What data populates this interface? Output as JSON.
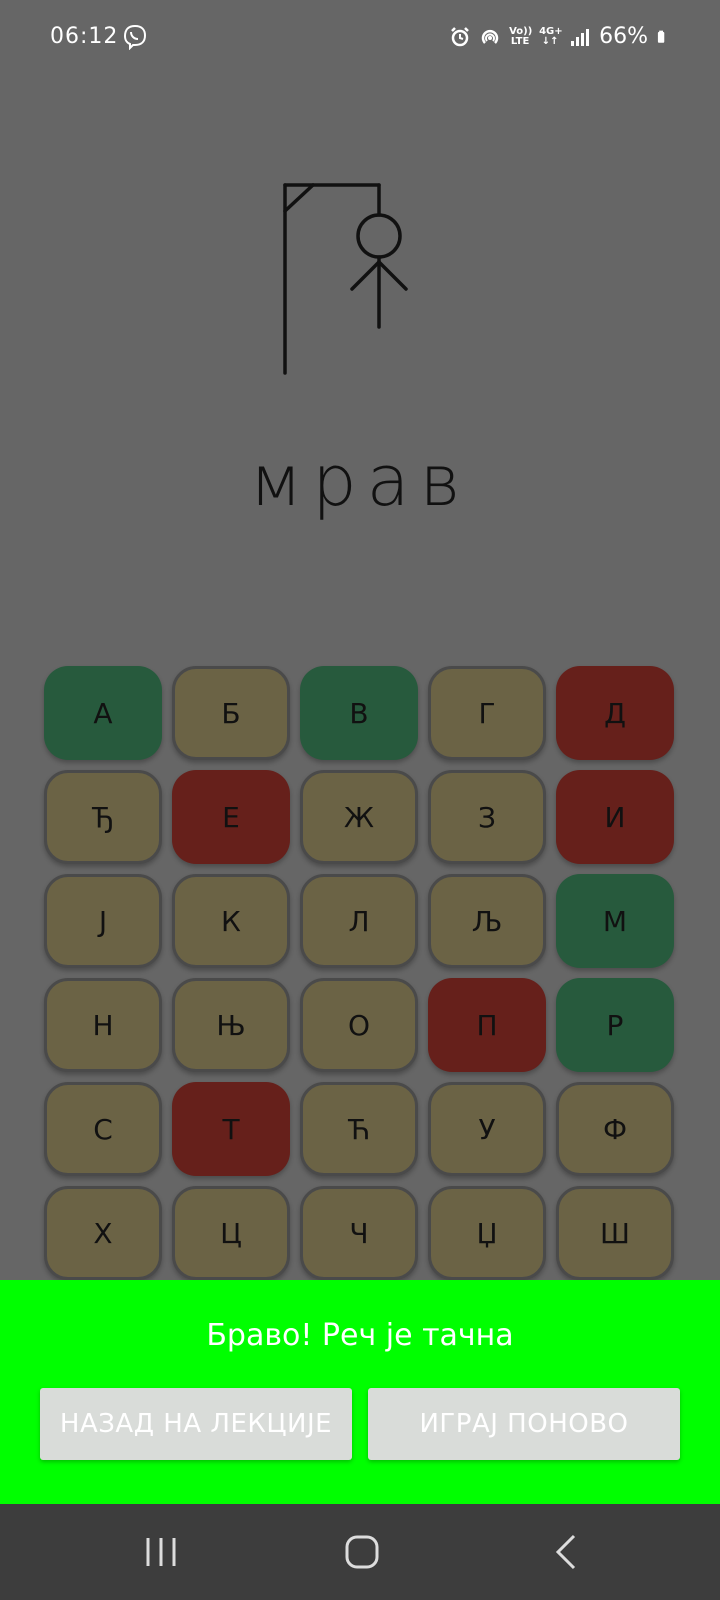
{
  "status_bar": {
    "time": "06:12",
    "battery": "66%",
    "network_top": "4G+",
    "volte_top": "Vo))",
    "volte_bottom": "LTE"
  },
  "game": {
    "word": "мрав"
  },
  "keyboard": {
    "keys": [
      {
        "letter": "А",
        "state": "correct"
      },
      {
        "letter": "Б",
        "state": "neutral"
      },
      {
        "letter": "В",
        "state": "correct"
      },
      {
        "letter": "Г",
        "state": "neutral"
      },
      {
        "letter": "Д",
        "state": "wrong"
      },
      {
        "letter": "Ђ",
        "state": "neutral"
      },
      {
        "letter": "Е",
        "state": "wrong"
      },
      {
        "letter": "Ж",
        "state": "neutral"
      },
      {
        "letter": "З",
        "state": "neutral"
      },
      {
        "letter": "И",
        "state": "wrong"
      },
      {
        "letter": "Ј",
        "state": "neutral"
      },
      {
        "letter": "К",
        "state": "neutral"
      },
      {
        "letter": "Л",
        "state": "neutral"
      },
      {
        "letter": "Љ",
        "state": "neutral"
      },
      {
        "letter": "М",
        "state": "correct"
      },
      {
        "letter": "Н",
        "state": "neutral"
      },
      {
        "letter": "Њ",
        "state": "neutral"
      },
      {
        "letter": "О",
        "state": "neutral"
      },
      {
        "letter": "П",
        "state": "wrong"
      },
      {
        "letter": "Р",
        "state": "correct"
      },
      {
        "letter": "С",
        "state": "neutral"
      },
      {
        "letter": "Т",
        "state": "wrong"
      },
      {
        "letter": "Ћ",
        "state": "neutral"
      },
      {
        "letter": "У",
        "state": "neutral"
      },
      {
        "letter": "Ф",
        "state": "neutral"
      },
      {
        "letter": "Х",
        "state": "neutral"
      },
      {
        "letter": "Ц",
        "state": "neutral"
      },
      {
        "letter": "Ч",
        "state": "neutral"
      },
      {
        "letter": "Џ",
        "state": "neutral"
      },
      {
        "letter": "Ш",
        "state": "neutral"
      }
    ]
  },
  "result": {
    "message": "Браво! Реч је тачна",
    "back_label": "НАЗАД НА ЛЕКЦИЈЕ",
    "again_label": "ИГРАЈ ПОНОВО"
  },
  "colors": {
    "background": "#666666",
    "correct": "#275a3d",
    "wrong": "#66201b",
    "neutral": "#6b6345",
    "success_panel": "#00ff00"
  }
}
